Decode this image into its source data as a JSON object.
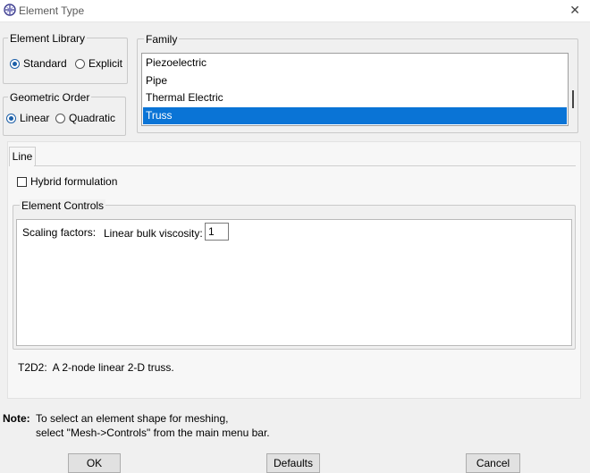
{
  "window": {
    "title": "Element Type"
  },
  "element_library": {
    "title": "Element Library",
    "options": [
      {
        "label": "Standard",
        "checked": true
      },
      {
        "label": "Explicit",
        "checked": false
      }
    ]
  },
  "geometric_order": {
    "title": "Geometric Order",
    "options": [
      {
        "label": "Linear",
        "checked": true
      },
      {
        "label": "Quadratic",
        "checked": false
      }
    ]
  },
  "family": {
    "title": "Family",
    "items": [
      "Piezoelectric",
      "Pipe",
      "Thermal Electric",
      "Truss"
    ],
    "selected": "Truss"
  },
  "tabs": [
    {
      "label": "Line",
      "active": true
    }
  ],
  "hybrid_formulation": {
    "label": "Hybrid formulation",
    "checked": false
  },
  "element_controls": {
    "title": "Element Controls",
    "scaling_label": "Scaling factors:",
    "viscosity_label": "Linear bulk viscosity:",
    "viscosity_value": "1"
  },
  "element_description": "T2D2:  A 2-node linear 2-D truss.",
  "note": {
    "label": "Note:",
    "line1": "To select an element shape for meshing,",
    "line2": "select \"Mesh->Controls\" from the main menu bar."
  },
  "buttons": {
    "ok": "OK",
    "defaults": "Defaults",
    "cancel": "Cancel"
  },
  "colors": {
    "selection": "#0a74d6",
    "radio_accent": "#1c5fa8"
  }
}
